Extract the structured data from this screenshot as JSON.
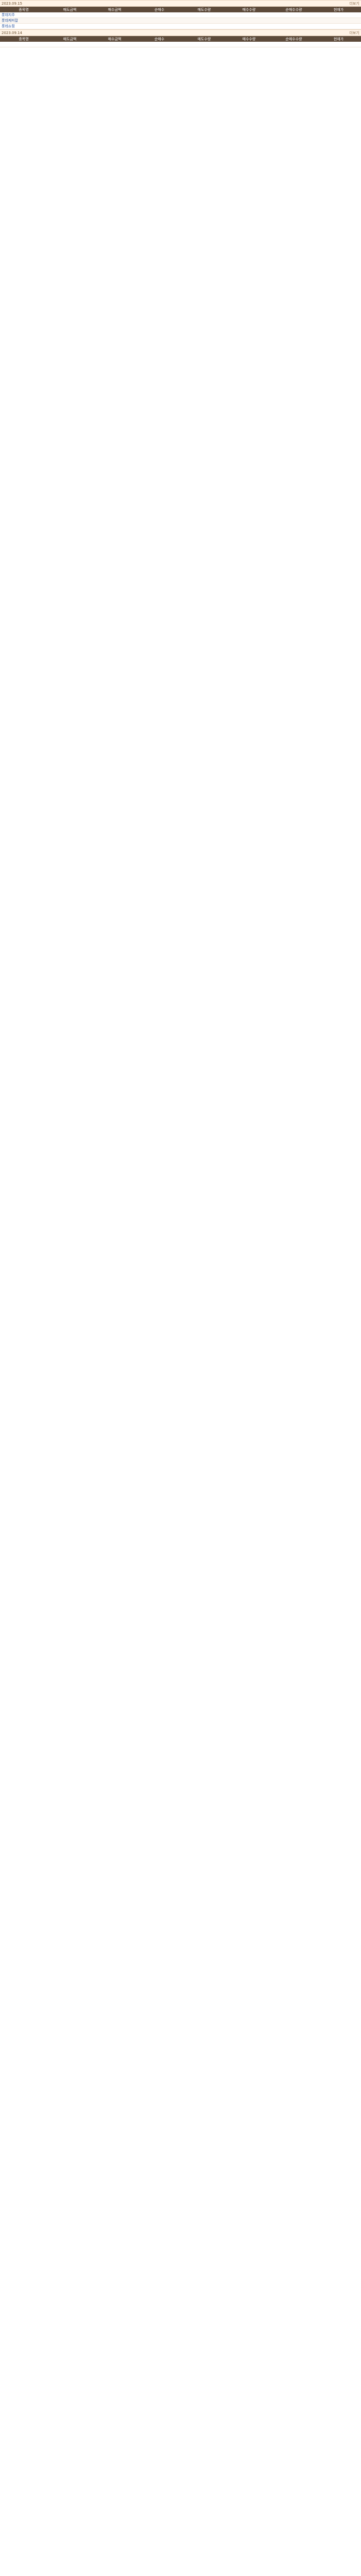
{
  "columns": [
    "종목명",
    "매도금액",
    "매수금액",
    "순매수",
    "매도수량",
    "매수수량",
    "순매수수량",
    "현재가"
  ],
  "blocks": [
    {
      "date": "2023.09.15",
      "summary": "",
      "more": "더보기",
      "rows": [
        {
          "name": "롯데지주",
          "c1": "",
          "c2": "",
          "c3": "",
          "c4": "",
          "c5": "",
          "c6": "",
          "c7": ""
        },
        {
          "name": "롯데케미칼",
          "c1": "",
          "c2": "",
          "c3": "",
          "c4": "",
          "c5": "",
          "c6": "",
          "c7": ""
        },
        {
          "name": "롯데쇼핑",
          "c1": "",
          "c2": "",
          "c3": "",
          "c4": "",
          "c5": "",
          "c6": "",
          "c7": ""
        }
      ]
    },
    {
      "date": "2023.09.14",
      "summary": "",
      "more": "더보기",
      "rows": [
        {
          "name": "",
          "c1": "",
          "c2": "",
          "c3": "",
          "c4": "",
          "c5": "",
          "c6": "",
          "c7": ""
        }
      ]
    }
  ]
}
